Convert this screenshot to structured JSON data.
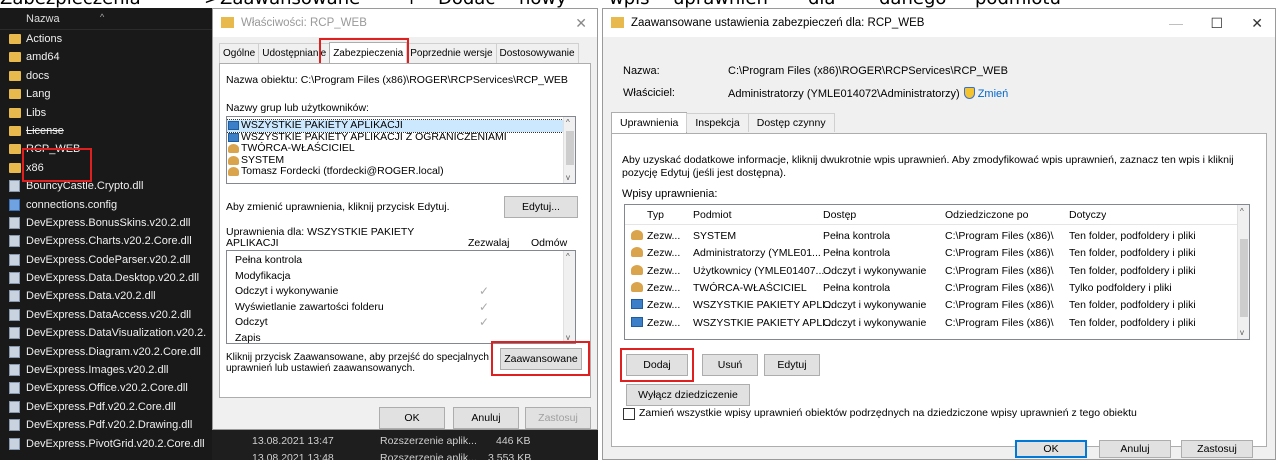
{
  "caption": {
    "words": [
      "Zabezpieczenia",
      ">",
      "Zaawansowane",
      "+",
      "Dodać",
      "nowy",
      "wpis",
      "uprawnień",
      "dla",
      "danego",
      "podmiotu"
    ]
  },
  "explorer": {
    "header": "Nazwa",
    "items": [
      {
        "name": "Actions",
        "type": "folder"
      },
      {
        "name": "amd64",
        "type": "folder"
      },
      {
        "name": "docs",
        "type": "folder"
      },
      {
        "name": "Lang",
        "type": "folder"
      },
      {
        "name": "Libs",
        "type": "folder"
      },
      {
        "name": "License",
        "type": "folder"
      },
      {
        "name": "RCP_WEB",
        "type": "folder"
      },
      {
        "name": "x86",
        "type": "folder"
      },
      {
        "name": "BouncyCastle.Crypto.dll",
        "type": "dll"
      },
      {
        "name": "connections.config",
        "type": "cfg"
      },
      {
        "name": "DevExpress.BonusSkins.v20.2.dll",
        "type": "dll"
      },
      {
        "name": "DevExpress.Charts.v20.2.Core.dll",
        "type": "dll"
      },
      {
        "name": "DevExpress.CodeParser.v20.2.dll",
        "type": "dll"
      },
      {
        "name": "DevExpress.Data.Desktop.v20.2.dll",
        "type": "dll"
      },
      {
        "name": "DevExpress.Data.v20.2.dll",
        "type": "dll"
      },
      {
        "name": "DevExpress.DataAccess.v20.2.dll",
        "type": "dll"
      },
      {
        "name": "DevExpress.DataVisualization.v20.2.",
        "type": "dll"
      },
      {
        "name": "DevExpress.Diagram.v20.2.Core.dll",
        "type": "dll"
      },
      {
        "name": "DevExpress.Images.v20.2.dll",
        "type": "dll"
      },
      {
        "name": "DevExpress.Office.v20.2.Core.dll",
        "type": "dll"
      },
      {
        "name": "DevExpress.Pdf.v20.2.Core.dll",
        "type": "dll"
      },
      {
        "name": "DevExpress.Pdf.v20.2.Drawing.dll",
        "type": "dll"
      },
      {
        "name": "DevExpress.PivotGrid.v20.2.Core.dll",
        "type": "dll"
      }
    ],
    "background_rows": [
      {
        "date": "13.08.2021 13:47",
        "kind": "Rozszerzenie aplik...",
        "size": "446 KB"
      },
      {
        "date": "13.08.2021 13:48",
        "kind": "Rozszerzenie aplik...",
        "size": "3 553 KB"
      }
    ]
  },
  "props": {
    "title": "Właściwości: RCP_WEB",
    "tabs": [
      "Ogólne",
      "Udostępnianie",
      "Zabezpieczenia",
      "Poprzednie wersje",
      "Dostosowywanie"
    ],
    "active_tab": "Zabezpieczenia",
    "object_name": "Nazwa obiektu:  C:\\Program Files (x86)\\ROGER\\RCPServices\\RCP_WEB",
    "groups_label": "Nazwy grup lub użytkowników:",
    "groups": [
      {
        "name": "WSZYSTKIE PAKIETY APLIKACJI",
        "icon": "pkg"
      },
      {
        "name": "WSZYSTKIE PAKIETY APLIKACJI Z OGRANICZENIAMI",
        "icon": "pkg"
      },
      {
        "name": "TWÓRCA-WŁAŚCICIEL",
        "icon": "usr"
      },
      {
        "name": "SYSTEM",
        "icon": "usr"
      },
      {
        "name": "Tomasz Fordecki (tfordecki@ROGER.local)",
        "icon": "usr"
      }
    ],
    "change_hint": "Aby zmienić uprawnienia, kliknij przycisk Edytuj.",
    "edit_button": "Edytuj...",
    "perms_for_line1": "Uprawnienia dla: WSZYSTKIE PAKIETY",
    "perms_for_line2": "APLIKACJI",
    "allow_col": "Zezwalaj",
    "deny_col": "Odmów",
    "permissions": [
      {
        "name": "Pełna kontrola",
        "allow": ""
      },
      {
        "name": "Modyfikacja",
        "allow": ""
      },
      {
        "name": "Odczyt i wykonywanie",
        "allow": "✓"
      },
      {
        "name": "Wyświetlanie zawartości folderu",
        "allow": "✓"
      },
      {
        "name": "Odczyt",
        "allow": "✓"
      },
      {
        "name": "Zapis",
        "allow": ""
      }
    ],
    "advanced_hint_line1": "Kliknij przycisk Zaawansowane, aby przejść do specjalnych",
    "advanced_hint_line2": "uprawnień lub ustawień zaawansowanych.",
    "advanced_button": "Zaawansowane",
    "ok": "OK",
    "cancel": "Anuluj",
    "apply": "Zastosuj"
  },
  "adv": {
    "title": "Zaawansowane ustawienia zabezpieczeń dla: RCP_WEB",
    "name_label": "Nazwa:",
    "name_value": "C:\\Program Files (x86)\\ROGER\\RCPServices\\RCP_WEB",
    "owner_label": "Właściciel:",
    "owner_value": "Administratorzy (YMLE014072\\Administratorzy)",
    "change_link": "Zmień",
    "tabs": [
      "Uprawnienia",
      "Inspekcja",
      "Dostęp czynny"
    ],
    "info_line1": "Aby uzyskać dodatkowe informacje, kliknij dwukrotnie wpis uprawnień. Aby zmodyfikować wpis uprawnień, zaznacz ten wpis i kliknij",
    "info_line2": "pozycję Edytuj (jeśli jest dostępna).",
    "entries_label": "Wpisy uprawnienia:",
    "columns": [
      "Typ",
      "Podmiot",
      "Dostęp",
      "Odziedziczone po",
      "Dotyczy"
    ],
    "rows": [
      {
        "type": "Zezw...",
        "subject": "SYSTEM",
        "access": "Pełna kontrola",
        "inherited": "C:\\Program Files (x86)\\",
        "applies": "Ten folder, podfoldery i pliki",
        "icon": "usr"
      },
      {
        "type": "Zezw...",
        "subject": "Administratorzy (YMLE01...",
        "access": "Pełna kontrola",
        "inherited": "C:\\Program Files (x86)\\",
        "applies": "Ten folder, podfoldery i pliki",
        "icon": "usr"
      },
      {
        "type": "Zezw...",
        "subject": "Użytkownicy (YMLE01407...",
        "access": "Odczyt i wykonywanie",
        "inherited": "C:\\Program Files (x86)\\",
        "applies": "Ten folder, podfoldery i pliki",
        "icon": "usr"
      },
      {
        "type": "Zezw...",
        "subject": "TWÓRCA-WŁAŚCICIEL",
        "access": "Pełna kontrola",
        "inherited": "C:\\Program Files (x86)\\",
        "applies": "Tylko podfoldery i pliki",
        "icon": "usr"
      },
      {
        "type": "Zezw...",
        "subject": "WSZYSTKIE PAKIETY APLI...",
        "access": "Odczyt i wykonywanie",
        "inherited": "C:\\Program Files (x86)\\",
        "applies": "Ten folder, podfoldery i pliki",
        "icon": "pkg"
      },
      {
        "type": "Zezw...",
        "subject": "WSZYSTKIE PAKIETY APLI...",
        "access": "Odczyt i wykonywanie",
        "inherited": "C:\\Program Files (x86)\\",
        "applies": "Ten folder, podfoldery i pliki",
        "icon": "pkg"
      }
    ],
    "add_button": "Dodaj",
    "remove_button": "Usuń",
    "edit_button": "Edytuj",
    "disable_inheritance_button": "Wyłącz dziedziczenie",
    "replace_checkbox_label": "Zamień wszystkie wpisy uprawnień obiektów podrzędnych na dziedziczone wpisy uprawnień z tego obiektu",
    "ok": "OK",
    "cancel": "Anuluj",
    "apply": "Zastosuj"
  },
  "colors": {
    "highlight_red": "#e02020",
    "explorer_bg": "#191919",
    "dialog_bg": "#f0f0f0",
    "link": "#0066cc"
  }
}
